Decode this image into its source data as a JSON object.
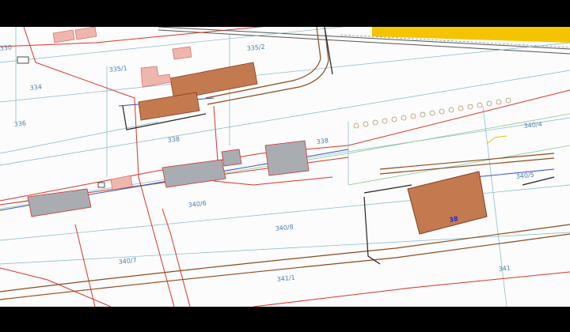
{
  "parcels": {
    "p335_2": "335/2",
    "p335_1": "335/1",
    "p334": "334",
    "p336": "336",
    "p338a": "338",
    "p338b": "338",
    "p340_6": "340/6",
    "p340_8": "340/8",
    "p340_7": "340/7",
    "p341_1": "341/1",
    "p340_4": "340/4",
    "p340_5": "340/5",
    "p341": "341",
    "p330": "330"
  },
  "highlight": {
    "label": "38"
  },
  "colors": {
    "background": "#fbfcfb",
    "building_brown": "#c47a4f",
    "building_pink": "#efb6ad",
    "building_gray": "#a9adb1",
    "railway_yellow": "#f4c400",
    "road_brown": "#8b4a1f",
    "boundary_red": "#d9342b",
    "utility_blue": "#3248c8",
    "parcel_teal": "#7fb6c9"
  }
}
